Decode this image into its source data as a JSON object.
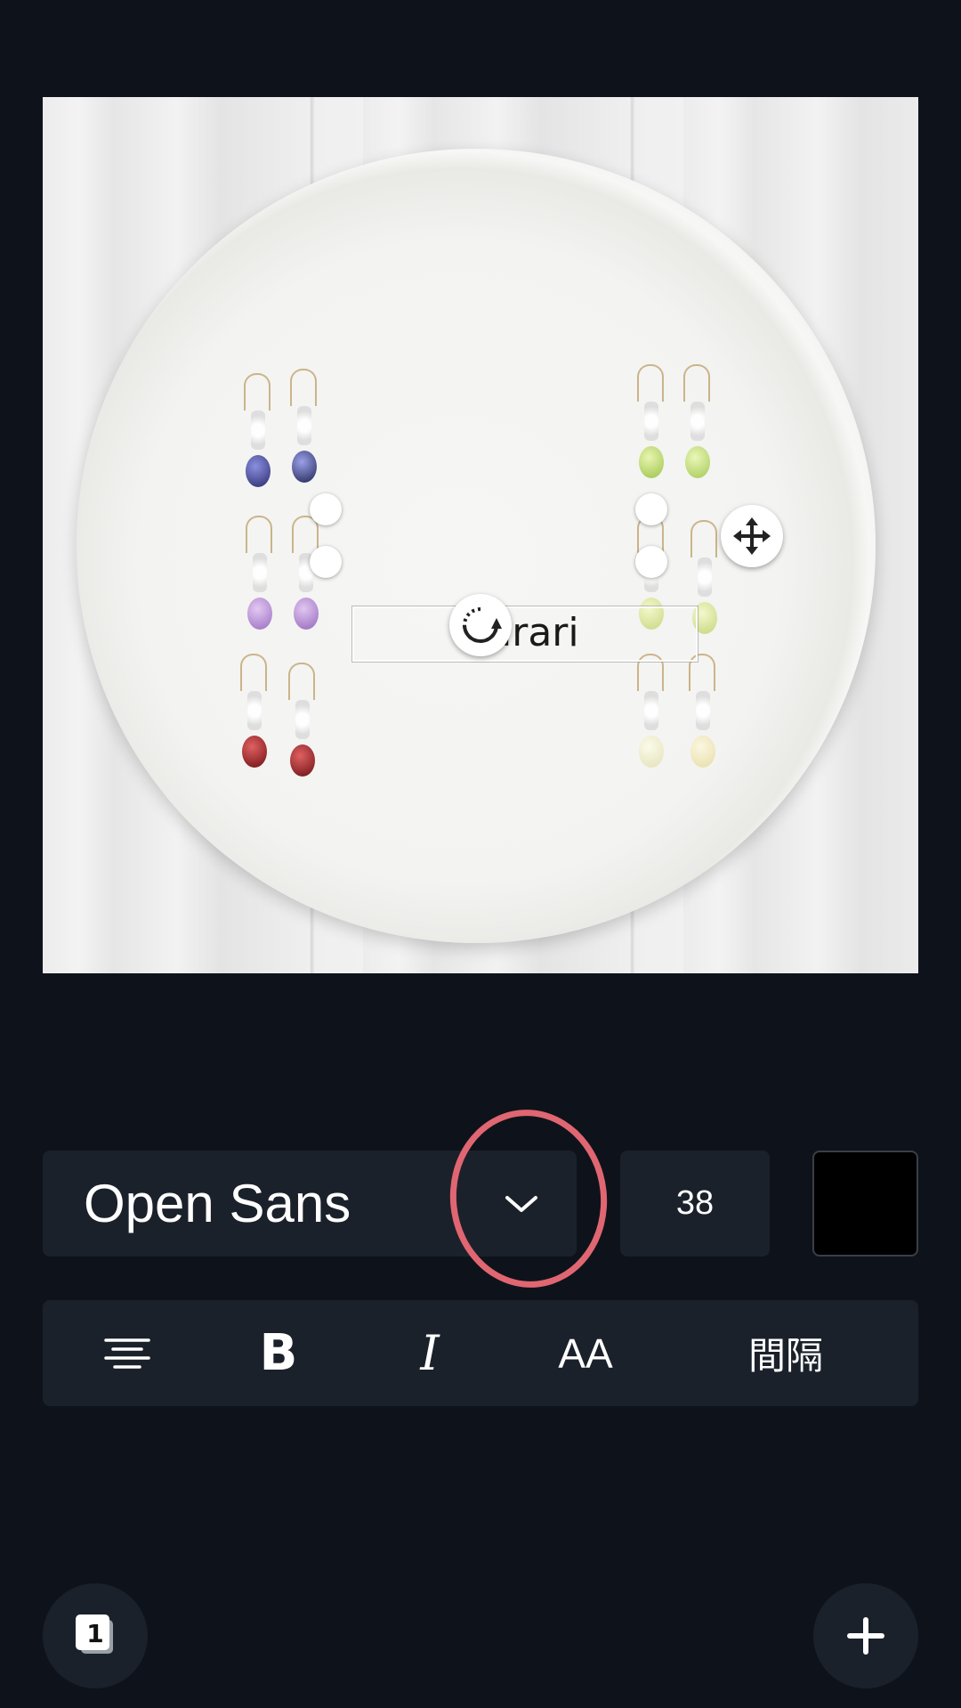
{
  "canvas": {
    "selected_text": "sarari"
  },
  "text_toolbar": {
    "font_family": "Open Sans",
    "font_size": "38",
    "text_color": "#000000",
    "spacing_label": "間隔",
    "case_label": "AA",
    "bold_label": "B",
    "italic_label": "I"
  },
  "bottom_bar": {
    "page_count": "1"
  },
  "colors": {
    "background": "#0e131b",
    "panel": "#1b212b",
    "annotation": "#e06672"
  }
}
